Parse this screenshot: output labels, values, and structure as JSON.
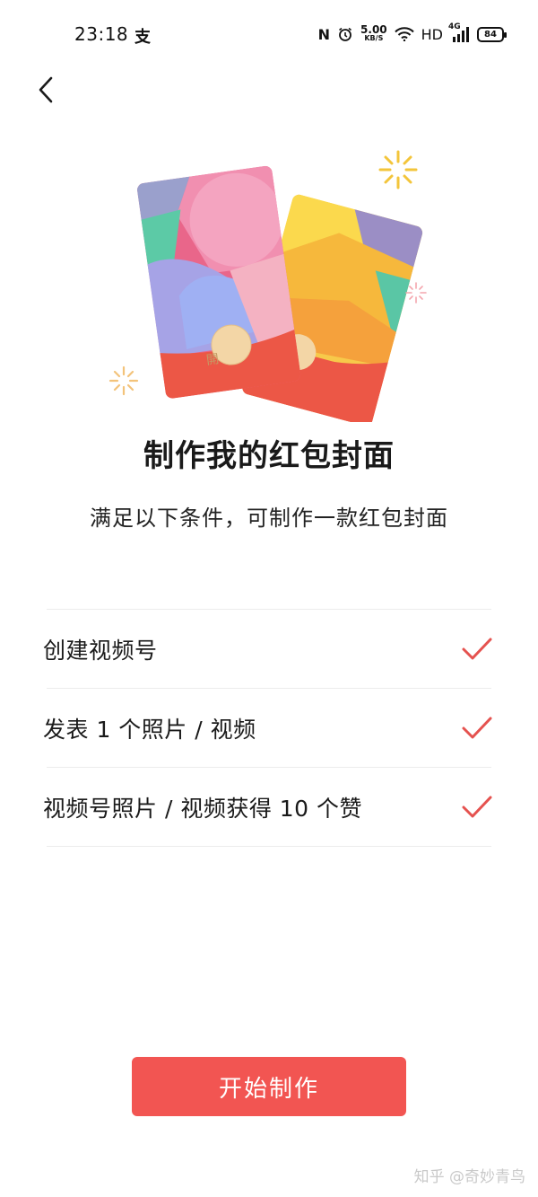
{
  "status_bar": {
    "time": "23:18",
    "alipay_icon": "alipay-icon",
    "nfc": "N",
    "speed_value": "5.00",
    "speed_unit": "KB/S",
    "hd": "HD",
    "network": "4G",
    "battery": "84"
  },
  "nav": {
    "back_icon": "chevron-left-icon"
  },
  "page": {
    "title": "制作我的红包封面",
    "subtitle": "满足以下条件，可制作一款红包封面"
  },
  "conditions": [
    {
      "label": "创建视频号",
      "done": true
    },
    {
      "label": "发表 1 个照片 / 视频",
      "done": true
    },
    {
      "label": "视频号照片 / 视频获得 10 个赞",
      "done": true
    }
  ],
  "envelope": {
    "seal_text": "開"
  },
  "actions": {
    "start_label": "开始制作"
  },
  "watermark": "知乎 @奇妙青鸟",
  "colors": {
    "accent": "#f25552",
    "check": "#e5524f"
  }
}
